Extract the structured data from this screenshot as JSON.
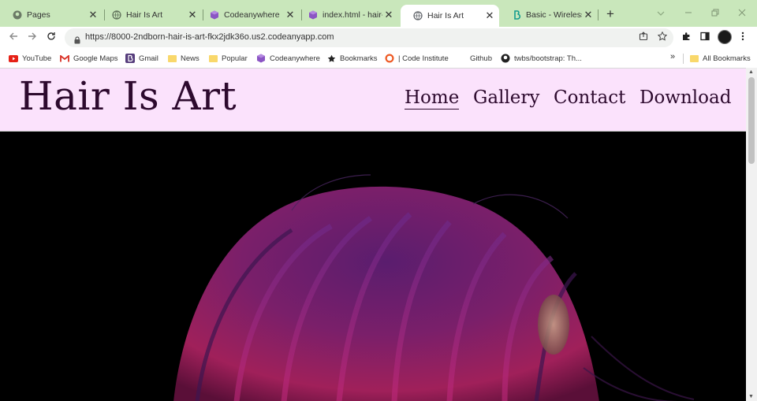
{
  "browser": {
    "tabs": [
      {
        "title": "Pages",
        "icon": "github-icon",
        "active": false
      },
      {
        "title": "Hair Is Art",
        "icon": "globe-icon",
        "active": false
      },
      {
        "title": "Codeanywhere",
        "icon": "cube-icon",
        "active": false
      },
      {
        "title": "index.html - hair-is",
        "icon": "cube-icon",
        "active": false
      },
      {
        "title": "Hair Is Art",
        "icon": "globe-icon",
        "active": true
      },
      {
        "title": "Basic - Wireless",
        "icon": "bootstrap-icon",
        "active": false
      }
    ],
    "close_glyph": "✕",
    "new_tab_glyph": "+",
    "url": "https://8000-2ndborn-hair-is-art-fkx2jdk36o.us2.codeanyapp.com",
    "tab_strip_color": "#c9e7bb"
  },
  "bookmarks": {
    "items": [
      {
        "label": "YouTube",
        "icon": "youtube-icon"
      },
      {
        "label": "Google Maps",
        "icon": "gmail-icon"
      },
      {
        "label": "Gmail",
        "icon": "bootstrap-b-icon"
      },
      {
        "label": "News",
        "icon": "folder-icon"
      },
      {
        "label": "Popular",
        "icon": "folder-icon"
      },
      {
        "label": "Codeanywhere",
        "icon": "cube-icon"
      },
      {
        "label": "Bookmarks",
        "icon": "star-icon"
      },
      {
        "label": "| Code Institute",
        "icon": "ring-icon"
      },
      {
        "label": "Github",
        "icon": "none"
      },
      {
        "label": "twbs/bootstrap: Th...",
        "icon": "github-icon"
      }
    ],
    "more": "»",
    "all_bookmarks": "All Bookmarks"
  },
  "site": {
    "title": "Hair Is Art",
    "nav": [
      {
        "label": "Home",
        "active": true
      },
      {
        "label": "Gallery",
        "active": false
      },
      {
        "label": "Contact",
        "active": false
      },
      {
        "label": "Download",
        "active": false
      }
    ],
    "header_bg": "#fbe2fc",
    "text_color": "#2d0a2e"
  }
}
